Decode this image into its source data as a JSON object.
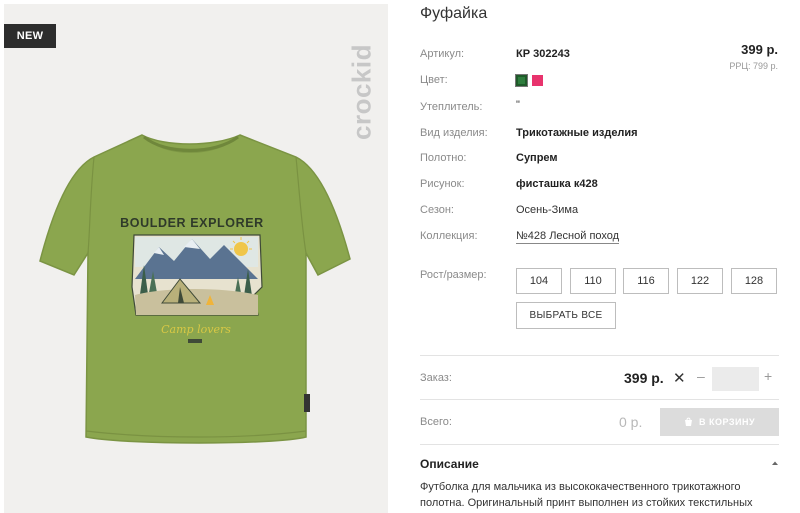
{
  "badge": "NEW",
  "brand_watermark": "crockid",
  "product": {
    "title": "Фуфайка",
    "price": "399 р.",
    "rrp": "РРЦ: 799 р."
  },
  "specs": {
    "article": {
      "label": "Артикул:",
      "value": "КР 302243"
    },
    "color": {
      "label": "Цвет:",
      "swatches": [
        "#2e7d3d",
        "#e8336d"
      ]
    },
    "insulation": {
      "label": "Утеплитель:",
      "value": "\""
    },
    "type": {
      "label": "Вид изделия:",
      "value": "Трикотажные изделия"
    },
    "fabric": {
      "label": "Полотно:",
      "value": "Супрем"
    },
    "print": {
      "label": "Рисунок:",
      "value": "фисташка к428"
    },
    "season": {
      "label": "Сезон:",
      "value": "Осень-Зима"
    },
    "collection": {
      "label": "Коллекция:",
      "value": "№428 Лесной поход"
    }
  },
  "sizes": {
    "label": "Рост/размер:",
    "options": [
      "104",
      "110",
      "116",
      "122",
      "128"
    ],
    "select_all": "ВЫБРАТЬ ВСЕ"
  },
  "order": {
    "label": "Заказ:",
    "price": "399 р.",
    "remove": "✕",
    "minus": "–",
    "plus": "+",
    "quantity": ""
  },
  "total": {
    "label": "Всего:",
    "value": "0 р.",
    "cart_button": "В КОРЗИНУ"
  },
  "description": {
    "title": "Описание",
    "text": "Футболка для мальчика из высококачественного трикотажного полотна. Оригинальный принт выполнен из стойких текстильных"
  },
  "print_art": {
    "headline": "BOULDER EXPLORER",
    "tagline": "Camp lovers"
  },
  "colors": {
    "shirt": "#8ba64e",
    "badge_bg": "#2d2d2d",
    "cart_button_bg": "#dcdcdc"
  }
}
